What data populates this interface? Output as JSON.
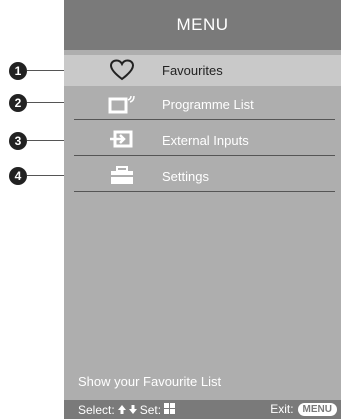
{
  "menu": {
    "title": "MENU",
    "items": [
      {
        "label": "Favourites",
        "icon": "heart-icon",
        "selected": true
      },
      {
        "label": "Programme List",
        "icon": "tv-icon",
        "selected": false
      },
      {
        "label": "External Inputs",
        "icon": "input-icon",
        "selected": false
      },
      {
        "label": "Settings",
        "icon": "toolbox-icon",
        "selected": false
      }
    ]
  },
  "callouts": [
    "1",
    "2",
    "3",
    "4"
  ],
  "hint": "Show your Favourite List",
  "footer": {
    "select_label": "Select:",
    "set_label": "Set:",
    "exit_label": "Exit:",
    "exit_key": "MENU"
  },
  "colors": {
    "panel_bg": "#aeaeae",
    "bar_bg": "#7a7a7a",
    "selected_bg": "#c9c9c9"
  }
}
